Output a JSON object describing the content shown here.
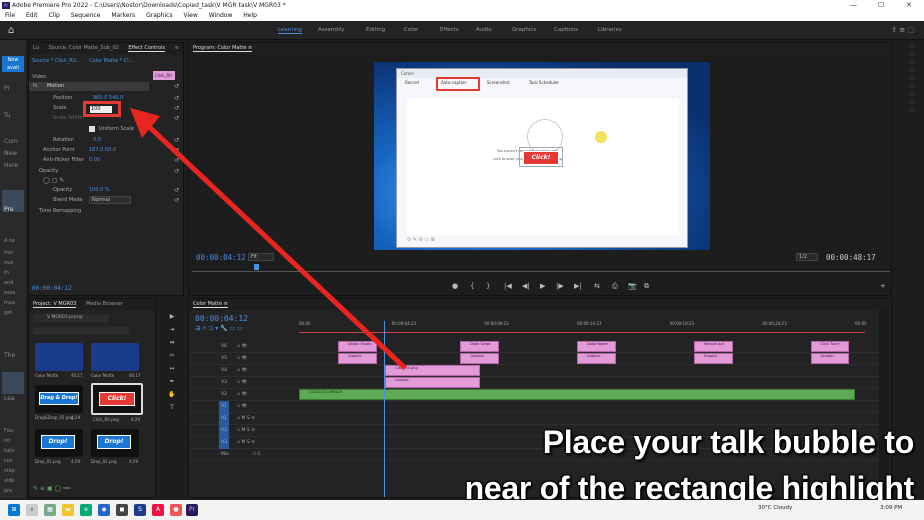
{
  "window": {
    "title": "Adobe Premiere Pro 2022 - C:\\Users\\Nostor\\Downloads\\Copied_task\\V MGR task\\V MGR03 *",
    "controls": [
      "—",
      "☐",
      "✕"
    ]
  },
  "menu": [
    "File",
    "Edit",
    "Clip",
    "Sequence",
    "Markers",
    "Graphics",
    "View",
    "Window",
    "Help"
  ],
  "workspaces": [
    "Learning",
    "Assembly",
    "Editing",
    "Color",
    "Effects",
    "Audio",
    "Graphics",
    "Captions",
    "Libraries"
  ],
  "left_strip": {
    "new_label": "New avail",
    "lines": [
      "Pr",
      "Tu",
      "Com",
      "New",
      "Here",
      "Pre",
      "A tw",
      "min",
      "ove",
      "th",
      "and",
      "esse",
      "mea",
      "get",
      "The",
      "Lea",
      "Fou",
      "int",
      "tuto",
      "cov",
      "step",
      "vide",
      "pro"
    ]
  },
  "effect_controls": {
    "tabs": [
      "Lu",
      "Source: Color Matte_Sub_02",
      "Effect Controls",
      "≡"
    ],
    "source": "Source * Click_R0...",
    "sequence": "Color Matte * Cl...",
    "clip_chip": "Click_R0",
    "section_video": "Video",
    "motion": "Motion",
    "rows": [
      {
        "label": "Position",
        "value": "960.0   540.0"
      },
      {
        "label": "Scale",
        "value": "100"
      },
      {
        "label": "Scale Width",
        "value": ""
      },
      {
        "label": "Uniform Scale",
        "value": ""
      },
      {
        "label": "Rotation",
        "value": "0.0"
      },
      {
        "label": "Anchor Point",
        "value": "187.0   60.0"
      },
      {
        "label": "Anti-flicker Filter",
        "value": "0.00"
      }
    ],
    "opacity": "Opacity",
    "opacity_value": "100.0 %",
    "blend_label": "Blend Mode",
    "blend_value": "Normal",
    "time_remap": "Time Remapping",
    "timecode": "00:00:04:12"
  },
  "program_monitor": {
    "tab": "Program: Color Matte ≡",
    "timecode_left": "00:00:04:12",
    "fit": "Fit",
    "ratio": "1/2",
    "timecode_right": "00:00:48:17",
    "app": {
      "title": "Cotale",
      "tabs": [
        "Record",
        "Auto-caption",
        "Screenshot",
        "Task Scheduler"
      ],
      "click_label": "Click!",
      "caption_line1": "You haven't recorded anything yet",
      "caption_line2": "click   to start your first screen recording"
    },
    "transport": [
      "●",
      "{",
      "}",
      "|◀",
      "◀|",
      "▶",
      "|▶",
      "▶|",
      "⇆",
      "⎙",
      "⧉",
      "📷",
      "⧉",
      "+"
    ]
  },
  "project": {
    "tabs": [
      "Project: V MGR03",
      "Media Browser"
    ],
    "file": "V MGR03.prproj",
    "items": [
      {
        "name": "Color Matte",
        "duration": "46;17"
      },
      {
        "name": "Color Matte",
        "duration": "46;17"
      },
      {
        "name": "Drag&Drop_02.png",
        "duration": "4;29",
        "badge": "Drag & Drop!"
      },
      {
        "name": "Click_R0.png",
        "duration": "4;29",
        "badge": "Click!"
      },
      {
        "name": "Drop_01.png",
        "duration": "4;29",
        "badge": "Drop!"
      },
      {
        "name": "Drop_02.png",
        "duration": "4;29",
        "badge": "Drop!"
      }
    ]
  },
  "timeline": {
    "tab": "Color Matte ≡",
    "timecode": "00:00:04:12",
    "ticks": [
      "00:00",
      "00:00:04:23",
      "00:00:09:23",
      "00:00:14:23",
      "00:00:19:23",
      "00:00:24:23",
      "00:00"
    ],
    "tracks": [
      "V6",
      "V5",
      "V4",
      "V3",
      "V2",
      "V1",
      "A1",
      "A2",
      "A3",
      "Mix"
    ],
    "mix_value": "0.0",
    "clips": [
      {
        "label": "Dadao Studio",
        "row": 0,
        "start": 0.07,
        "width": 0.07
      },
      {
        "label": "Graphic",
        "row": 1,
        "start": 0.07,
        "width": 0.07
      },
      {
        "label": "Dada Syste",
        "row": 0,
        "start": 0.29,
        "width": 0.07
      },
      {
        "label": "Graphic",
        "row": 1,
        "start": 0.29,
        "width": 0.07
      },
      {
        "label": "Dada Name",
        "row": 0,
        "start": 0.5,
        "width": 0.07
      },
      {
        "label": "Graphic",
        "row": 1,
        "start": 0.5,
        "width": 0.07
      },
      {
        "label": "Sample Aut",
        "row": 0,
        "start": 0.71,
        "width": 0.07
      },
      {
        "label": "Graphic",
        "row": 1,
        "start": 0.71,
        "width": 0.07
      },
      {
        "label": "Click Too! h",
        "row": 0,
        "start": 0.92,
        "width": 0.07
      },
      {
        "label": "Graphic",
        "row": 1,
        "start": 0.92,
        "width": 0.07
      },
      {
        "label": "Click_R0.png",
        "row": 2,
        "start": 0.155,
        "width": 0.17
      },
      {
        "label": "Graphic",
        "row": 3,
        "start": 0.155,
        "width": 0.17
      },
      {
        "label": "22222220_165400",
        "row": 4,
        "start": 0.0,
        "width": 1.0,
        "green": true
      }
    ]
  },
  "overlay": {
    "line1": "Place your talk bubble to",
    "line2": "near of the rectangle highlight"
  },
  "taskbar": {
    "weather": "30°C  Cloudy",
    "time": "3:09 PM"
  },
  "colors": {
    "accent": "#4a90e2",
    "highlight_red": "#e53935",
    "clip_pink": "#e39bd8",
    "clip_green": "#5daa55"
  }
}
